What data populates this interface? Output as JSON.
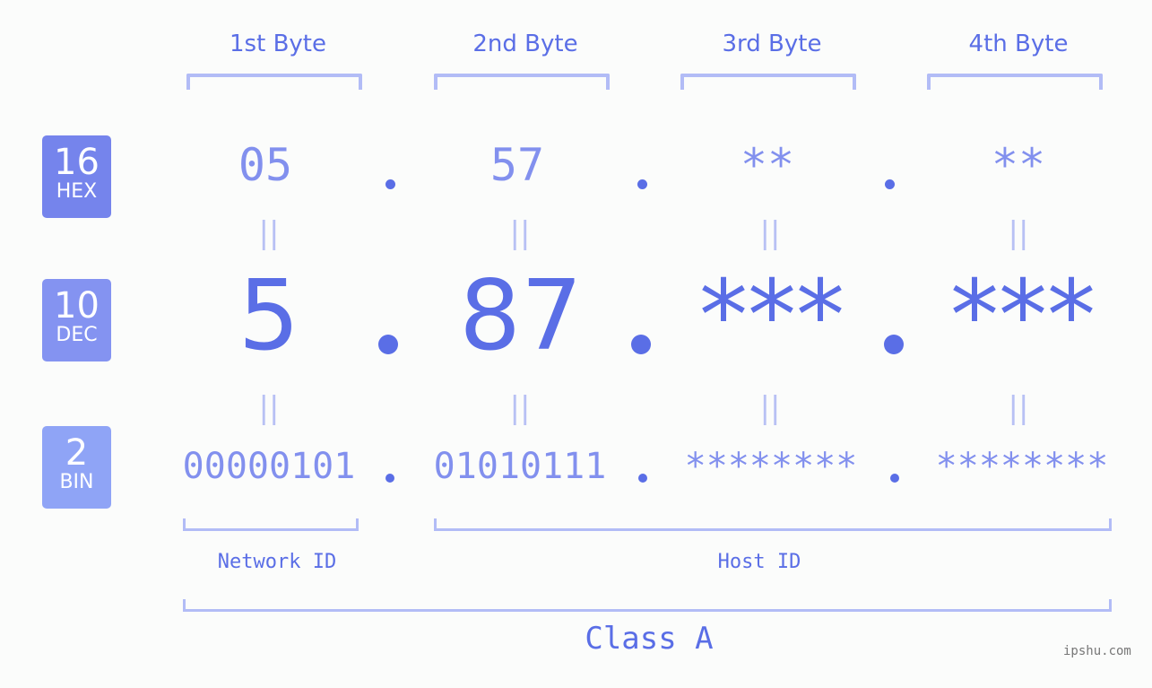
{
  "headers": [
    "1st Byte",
    "2nd Byte",
    "3rd Byte",
    "4th Byte"
  ],
  "badges": [
    {
      "num": "16",
      "label": "HEX",
      "color": "#7584ec"
    },
    {
      "num": "10",
      "label": "DEC",
      "color": "#8493f1"
    },
    {
      "num": "2",
      "label": "BIN",
      "color": "#8fa4f6"
    }
  ],
  "hex": [
    "05",
    "57",
    "**",
    "**"
  ],
  "dec": [
    "5",
    "87",
    "***",
    "***"
  ],
  "bin": [
    "00000101",
    "01010111",
    "********",
    "********"
  ],
  "equals_sign": "||",
  "network_label": "Network ID",
  "host_label": "Host ID",
  "class_label": "Class A",
  "watermark": "ipshu.com",
  "colors": {
    "accent": "#5a6ee6",
    "light": "#8290ee",
    "bracket": "#b2bcf6"
  }
}
